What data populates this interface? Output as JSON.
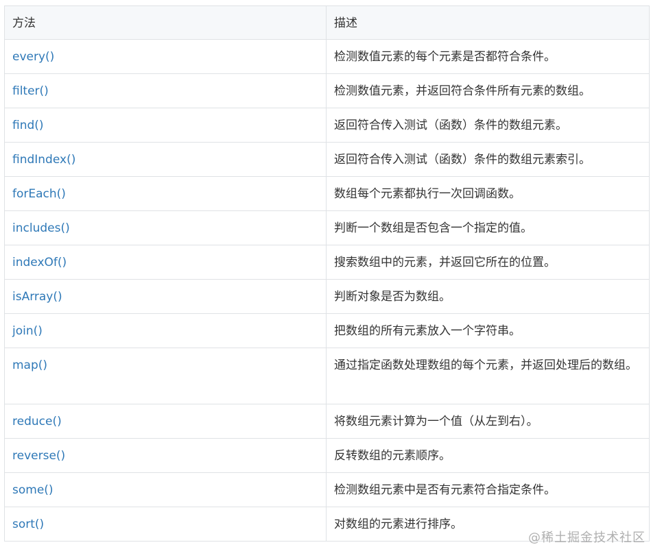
{
  "table": {
    "headers": [
      "方法",
      "描述"
    ],
    "rows": [
      {
        "method": "every()",
        "description": "检测数值元素的每个元素是否都符合条件。"
      },
      {
        "method": "filter()",
        "description": "检测数值元素，并返回符合条件所有元素的数组。"
      },
      {
        "method": "find()",
        "description": "返回符合传入测试（函数）条件的数组元素。"
      },
      {
        "method": "findIndex()",
        "description": "返回符合传入测试（函数）条件的数组元素索引。"
      },
      {
        "method": "forEach()",
        "description": "数组每个元素都执行一次回调函数。"
      },
      {
        "method": "includes()",
        "description": "判断一个数组是否包含一个指定的值。"
      },
      {
        "method": "indexOf()",
        "description": "搜索数组中的元素，并返回它所在的位置。"
      },
      {
        "method": "isArray()",
        "description": "判断对象是否为数组。"
      },
      {
        "method": "join()",
        "description": "把数组的所有元素放入一个字符串。"
      },
      {
        "method": "map()",
        "description": "通过指定函数处理数组的每个元素，并返回处理后的数组。"
      },
      {
        "method": "reduce()",
        "description": "将数组元素计算为一个值（从左到右）。"
      },
      {
        "method": "reverse()",
        "description": "反转数组的元素顺序。"
      },
      {
        "method": "some()",
        "description": "检测数组元素中是否有元素符合指定条件。"
      },
      {
        "method": "sort()",
        "description": "对数组的元素进行排序。"
      }
    ]
  },
  "watermark": "@稀土掘金技术社区",
  "colors": {
    "link": "#2e78b7",
    "header_bg": "#f6f8fa",
    "border": "#dfe2e5",
    "text": "#333333"
  }
}
